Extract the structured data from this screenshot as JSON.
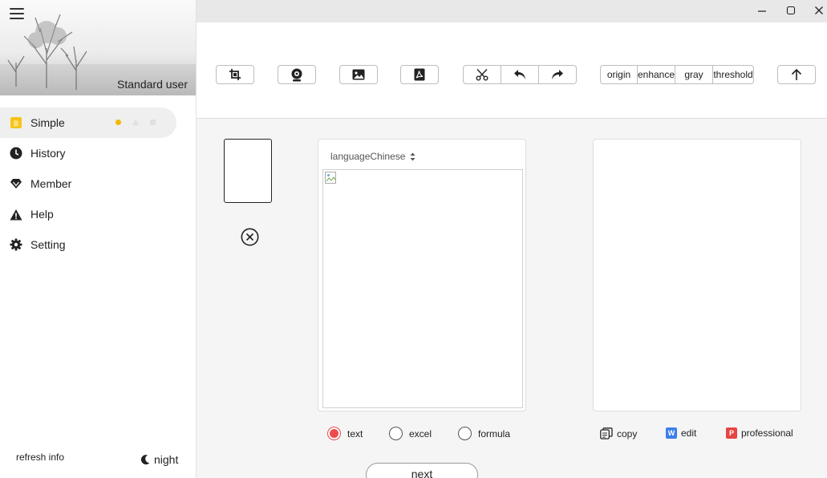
{
  "sidebar": {
    "user_label": "Standard user",
    "items": [
      {
        "label": "Simple",
        "icon": "simple-badge-icon",
        "active": true
      },
      {
        "label": "History",
        "icon": "clock-icon"
      },
      {
        "label": "Member",
        "icon": "diamond-icon"
      },
      {
        "label": "Help",
        "icon": "warning-icon"
      },
      {
        "label": "Setting",
        "icon": "gear-icon"
      }
    ],
    "refresh_label": "refresh info",
    "night_label": "night"
  },
  "toolbar": {
    "modes": [
      "origin",
      "enhance",
      "gray",
      "threshold"
    ]
  },
  "main": {
    "language_label": "languageChinese",
    "recognition_types": [
      {
        "label": "text",
        "selected": true
      },
      {
        "label": "excel",
        "selected": false
      },
      {
        "label": "formula",
        "selected": false
      }
    ],
    "result_actions": {
      "copy": "copy",
      "edit": "edit",
      "professional": "professional",
      "edit_badge": "W",
      "professional_badge": "P"
    },
    "next_label": "next"
  },
  "colors": {
    "accent_red": "#ef4b4b",
    "active_dot": "#f5b700",
    "edit_blue": "#3d7eea",
    "professional_red": "#e74444"
  }
}
